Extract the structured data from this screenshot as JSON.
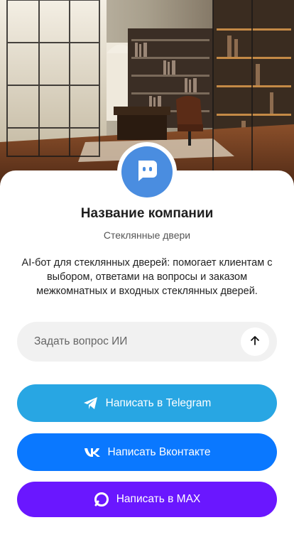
{
  "hero": {
    "image": "office-glass-doors-photo"
  },
  "company": {
    "avatar_icon": "chat-bot-icon",
    "name": "Название компании",
    "subtitle": "Стеклянные двери",
    "description": "AI-бот для стеклянных дверей: помогает клиентам с выбором, ответами на вопросы и заказом межкомнатных и входных стеклянных дверей."
  },
  "ask": {
    "placeholder": "Задать вопрос ИИ",
    "value": "",
    "send_icon": "arrow-up-icon"
  },
  "actions": {
    "telegram": {
      "label": "Написать в Telegram",
      "icon": "telegram-icon",
      "color": "#28a6e3"
    },
    "vk": {
      "label": "Написать Вконтакте",
      "icon": "vk-icon",
      "color": "#0a78ff"
    },
    "max": {
      "label": "Написать в MAX",
      "icon": "max-icon",
      "color": "#6a17ff"
    }
  },
  "colors": {
    "avatar": "#4a8de0",
    "input_bg": "#f1f1f1"
  }
}
